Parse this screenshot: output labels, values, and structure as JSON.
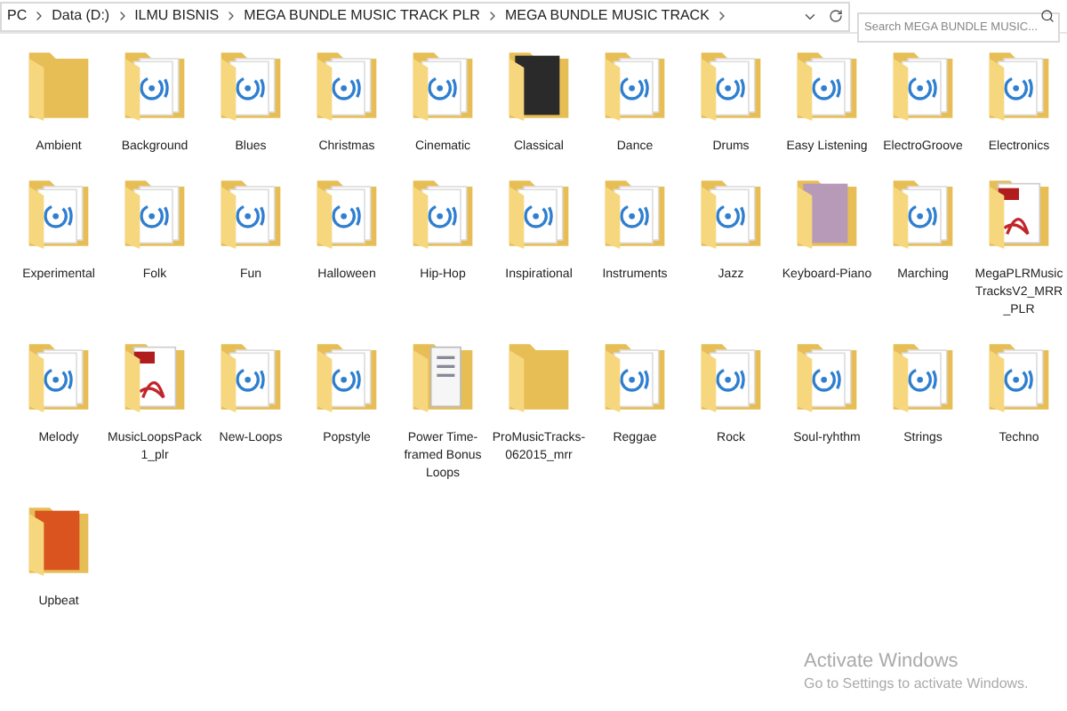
{
  "address_bar": {
    "path": [
      "PC",
      "Data (D:)",
      "ILMU BISNIS",
      "MEGA BUNDLE MUSIC TRACK PLR",
      "MEGA BUNDLE MUSIC TRACK"
    ]
  },
  "search": {
    "placeholder": "Search MEGA BUNDLE MUSIC..."
  },
  "folders": [
    {
      "name": "Ambient",
      "kind": "empty"
    },
    {
      "name": "Background",
      "kind": "music"
    },
    {
      "name": "Blues",
      "kind": "music"
    },
    {
      "name": "Christmas",
      "kind": "music"
    },
    {
      "name": "Cinematic",
      "kind": "music"
    },
    {
      "name": "Classical",
      "kind": "picture",
      "color": "#2a2a2a"
    },
    {
      "name": "Dance",
      "kind": "music"
    },
    {
      "name": "Drums",
      "kind": "music"
    },
    {
      "name": "Easy Listening",
      "kind": "music"
    },
    {
      "name": "ElectroGroove",
      "kind": "music"
    },
    {
      "name": "Electronics",
      "kind": "music"
    },
    {
      "name": "Experimental",
      "kind": "music"
    },
    {
      "name": "Folk",
      "kind": "music"
    },
    {
      "name": "Fun",
      "kind": "music"
    },
    {
      "name": "Halloween",
      "kind": "music"
    },
    {
      "name": "Hip-Hop",
      "kind": "music"
    },
    {
      "name": "Inspirational",
      "kind": "music"
    },
    {
      "name": "Instruments",
      "kind": "music"
    },
    {
      "name": "Jazz",
      "kind": "music"
    },
    {
      "name": "Keyboard-Piano",
      "kind": "picture",
      "color": "#b79ab8"
    },
    {
      "name": "Marching",
      "kind": "music"
    },
    {
      "name": "MegaPLRMusicTracksV2_MRR_PLR",
      "kind": "pdf"
    },
    {
      "name": "Melody",
      "kind": "music"
    },
    {
      "name": "MusicLoopsPack1_plr",
      "kind": "pdf"
    },
    {
      "name": "New-Loops",
      "kind": "music"
    },
    {
      "name": "Popstyle",
      "kind": "music"
    },
    {
      "name": "Power Time-framed Bonus Loops",
      "kind": "document"
    },
    {
      "name": "ProMusicTracks-062015_mrr",
      "kind": "empty"
    },
    {
      "name": "Reggae",
      "kind": "music"
    },
    {
      "name": "Rock",
      "kind": "music"
    },
    {
      "name": "Soul-ryhthm",
      "kind": "music"
    },
    {
      "name": "Strings",
      "kind": "music"
    },
    {
      "name": "Techno",
      "kind": "music"
    },
    {
      "name": "Upbeat",
      "kind": "picture",
      "color": "#d9541e"
    }
  ],
  "activation_notice": {
    "title": "Activate Windows",
    "message": "Go to Settings to activate Windows."
  }
}
